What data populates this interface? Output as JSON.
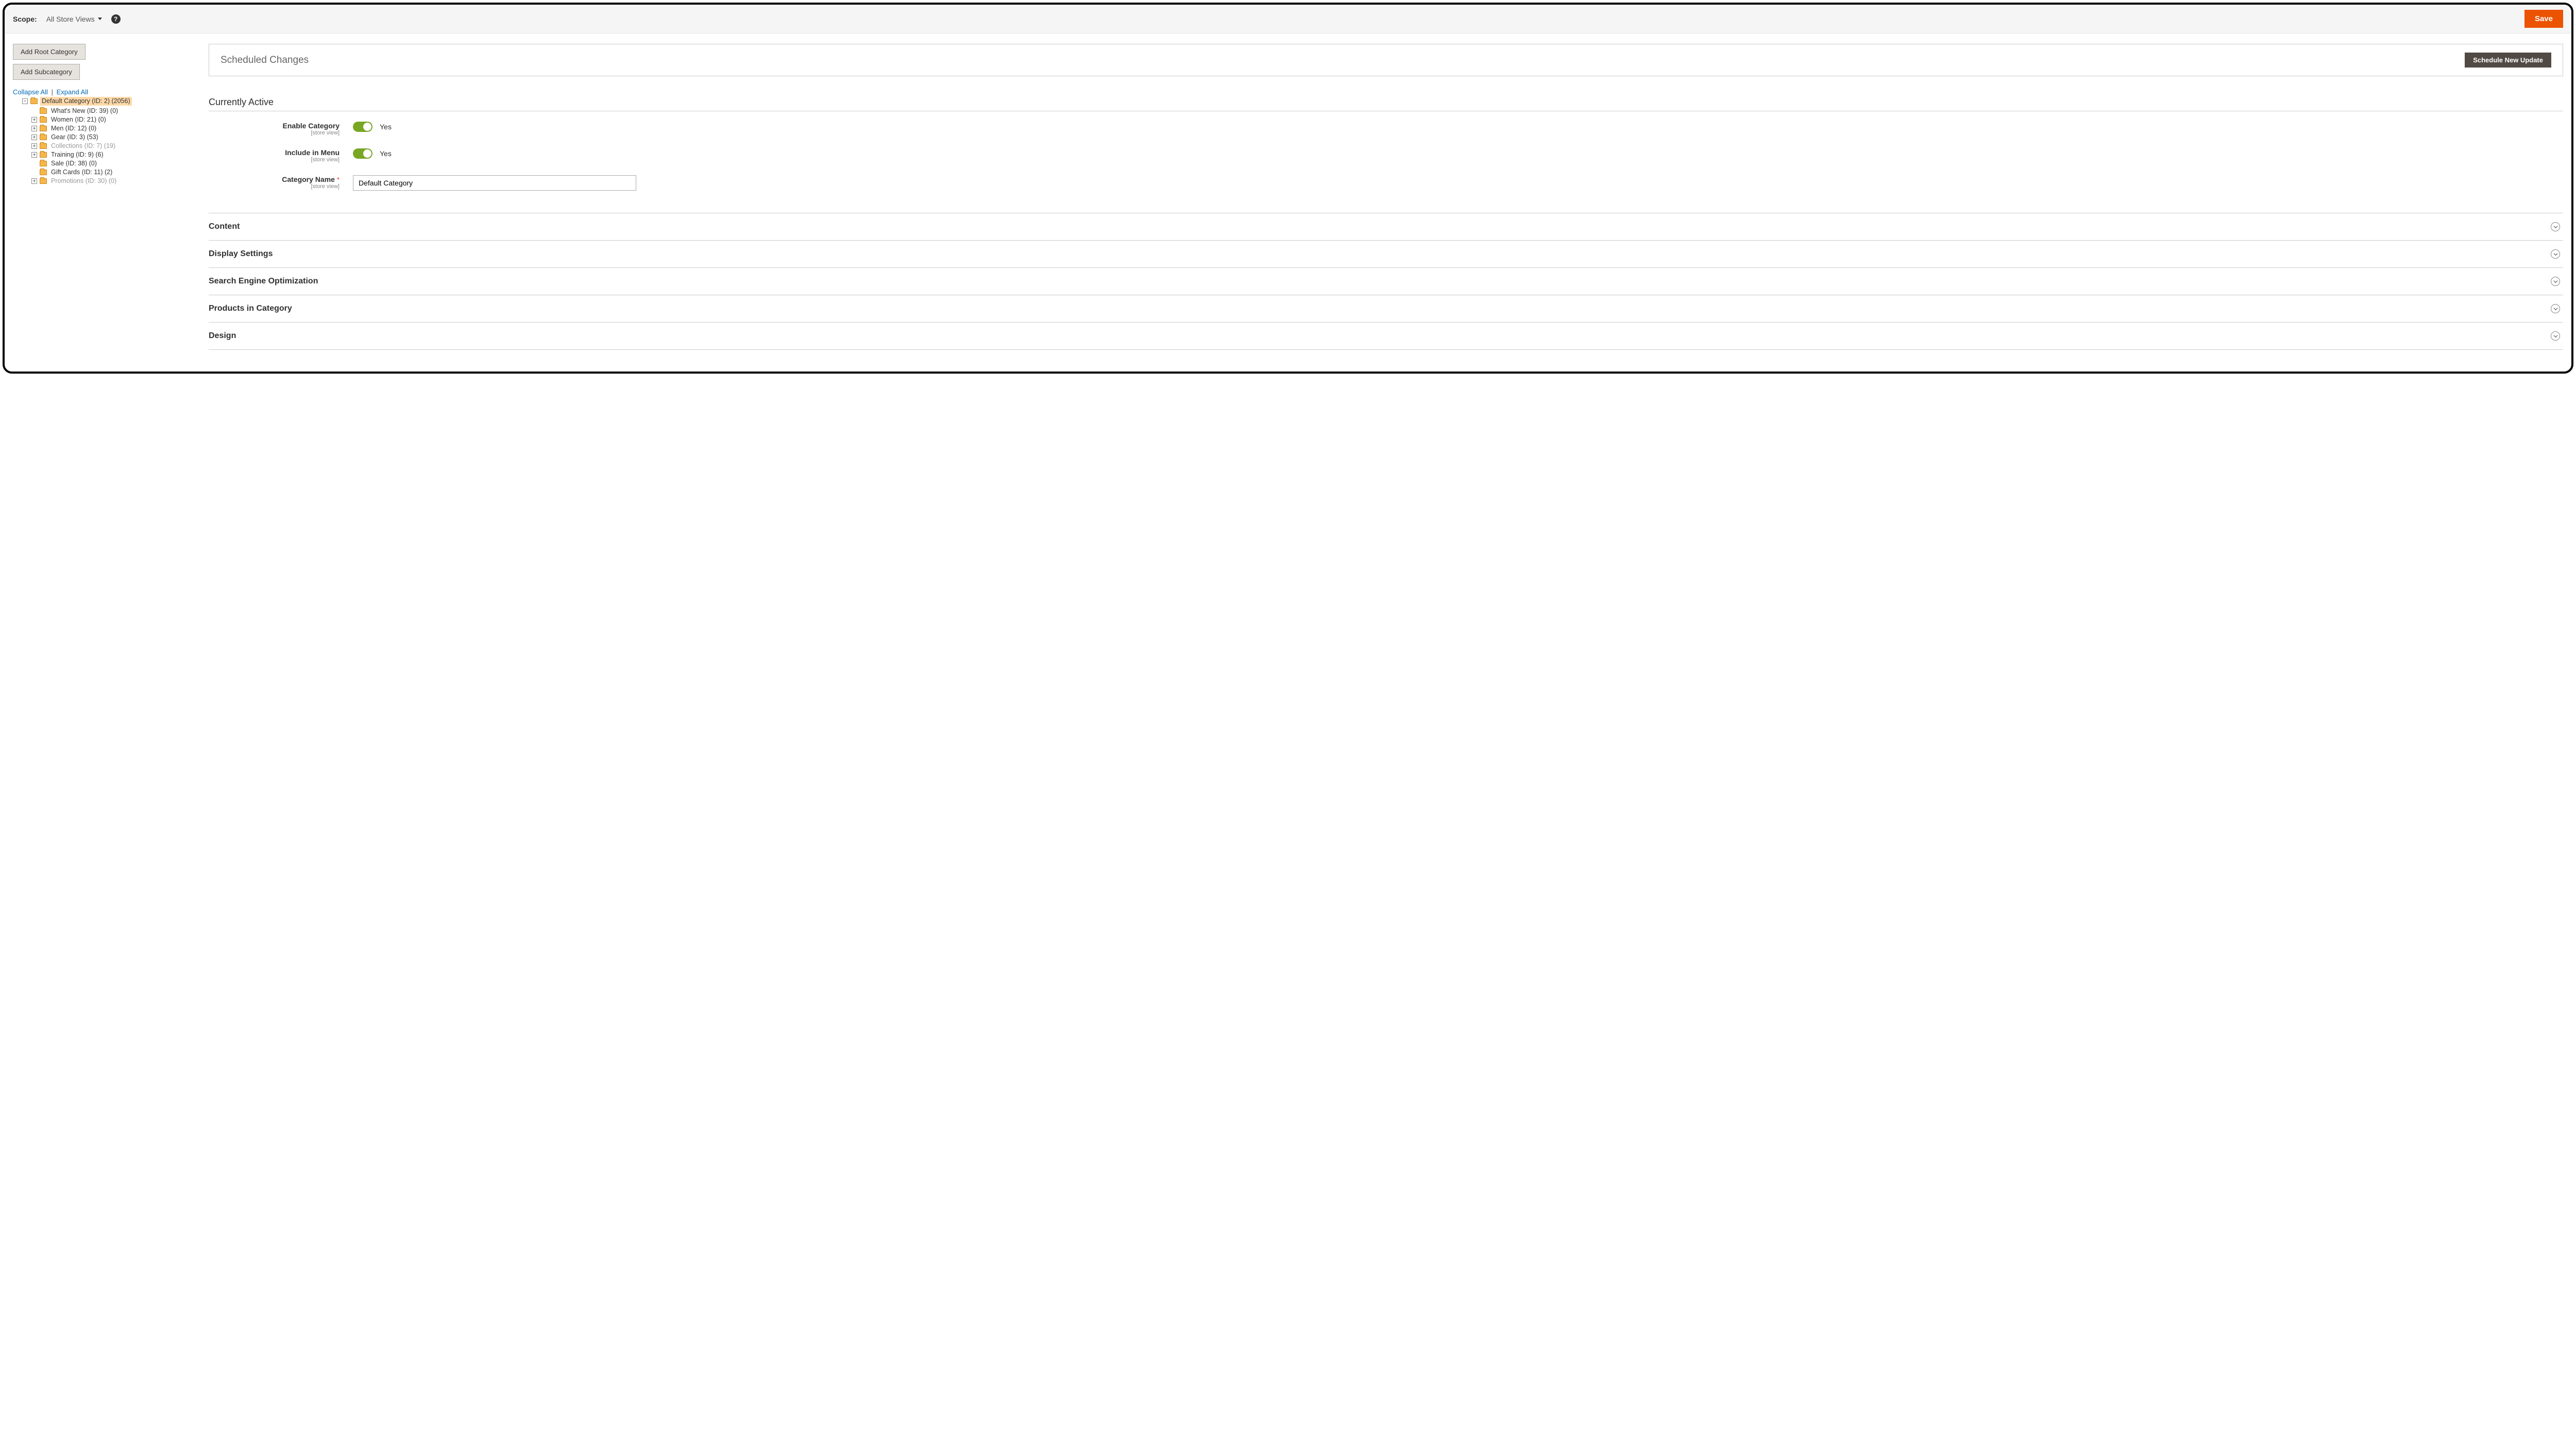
{
  "topbar": {
    "scope_label": "Scope:",
    "scope_value": "All Store Views",
    "save_label": "Save"
  },
  "sidebar": {
    "add_root_label": "Add Root Category",
    "add_sub_label": "Add Subcategory",
    "collapse_label": "Collapse All",
    "expand_label": "Expand All",
    "tree": {
      "root": {
        "label": "Default Category (ID: 2) (2056)"
      },
      "children": [
        {
          "label": "What's New (ID: 39) (0)",
          "expander": "",
          "muted": false
        },
        {
          "label": "Women (ID: 21) (0)",
          "expander": "+",
          "muted": false
        },
        {
          "label": "Men (ID: 12) (0)",
          "expander": "+",
          "muted": false
        },
        {
          "label": "Gear (ID: 3) (53)",
          "expander": "+",
          "muted": false
        },
        {
          "label": "Collections (ID: 7) (19)",
          "expander": "+",
          "muted": true
        },
        {
          "label": "Training (ID: 9) (6)",
          "expander": "+",
          "muted": false
        },
        {
          "label": "Sale (ID: 38) (0)",
          "expander": "",
          "muted": false
        },
        {
          "label": "Gift Cards (ID: 11) (2)",
          "expander": "",
          "muted": false
        },
        {
          "label": "Promotions (ID: 30) (0)",
          "expander": "+",
          "muted": true
        }
      ]
    }
  },
  "scheduled": {
    "title": "Scheduled Changes",
    "button": "Schedule New Update"
  },
  "active": {
    "heading": "Currently Active",
    "enable_label": "Enable Category",
    "enable_scope": "[store view]",
    "enable_value": "Yes",
    "include_label": "Include in Menu",
    "include_scope": "[store view]",
    "include_value": "Yes",
    "name_label": "Category Name",
    "name_scope": "[store view]",
    "name_value": "Default Category"
  },
  "accordions": [
    {
      "title": "Content"
    },
    {
      "title": "Display Settings"
    },
    {
      "title": "Search Engine Optimization"
    },
    {
      "title": "Products in Category"
    },
    {
      "title": "Design"
    }
  ]
}
